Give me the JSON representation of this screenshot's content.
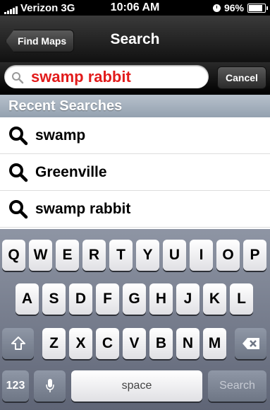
{
  "status": {
    "carrier": "Verizon",
    "network": "3G",
    "time": "10:06 AM",
    "battery": "96%",
    "battery_level": 0.96
  },
  "nav": {
    "back_label": "Find Maps",
    "title": "Search"
  },
  "search": {
    "value": "swamp rabbit",
    "cancel_label": "Cancel"
  },
  "recent": {
    "header": "Recent Searches",
    "items": [
      {
        "label": "swamp"
      },
      {
        "label": "Greenville"
      },
      {
        "label": "swamp rabbit"
      }
    ]
  },
  "keyboard": {
    "row1": [
      "Q",
      "W",
      "E",
      "R",
      "T",
      "Y",
      "U",
      "I",
      "O",
      "P"
    ],
    "row2": [
      "A",
      "S",
      "D",
      "F",
      "G",
      "H",
      "J",
      "K",
      "L"
    ],
    "row3": [
      "Z",
      "X",
      "C",
      "V",
      "B",
      "N",
      "M"
    ],
    "numbers_label": "123",
    "space_label": "space",
    "search_label": "Search"
  },
  "colors": {
    "search_text": "#e21b1b",
    "header_bg": "#a7b2bf"
  }
}
